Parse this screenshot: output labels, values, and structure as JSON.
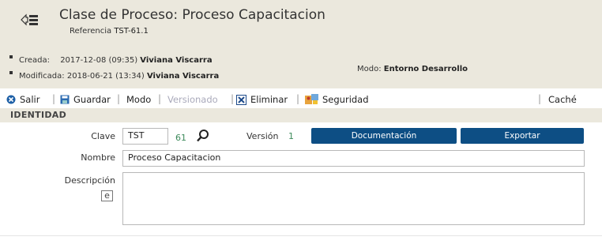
{
  "header": {
    "title": "Clase de Proceso: Proceso Capacitacion",
    "reference_label": "Referencia",
    "reference_value": "TST-61.1",
    "created_label": "Creada:",
    "created_date": "2017-12-08 (09:35)",
    "created_by": "Viviana Viscarra",
    "modified_label": "Modificada:",
    "modified_date": "2018-06-21 (13:34)",
    "modified_by": "Viviana Viscarra",
    "mode_label": "Modo:",
    "mode_value": "Entorno Desarrollo"
  },
  "toolbar": {
    "salir": "Salir",
    "guardar": "Guardar",
    "modo": "Modo",
    "versionado": "Versionado",
    "eliminar": "Eliminar",
    "seguridad": "Seguridad",
    "cache": "Caché"
  },
  "section": {
    "title": "IDENTIDAD"
  },
  "form": {
    "clave_label": "Clave",
    "clave_value": "TST",
    "clave_number": "61",
    "version_label": "Versión",
    "version_value": "1",
    "documentacion_button": "Documentación",
    "exportar_button": "Exportar",
    "nombre_label": "Nombre",
    "nombre_value": "Proceso Capacitacion",
    "descripcion_label": "Descripción",
    "descripcion_value": ""
  },
  "colors": {
    "header_bg": "#ebe8dd",
    "button_bg": "#0d4e84",
    "accent_green": "#3c8a5a"
  }
}
